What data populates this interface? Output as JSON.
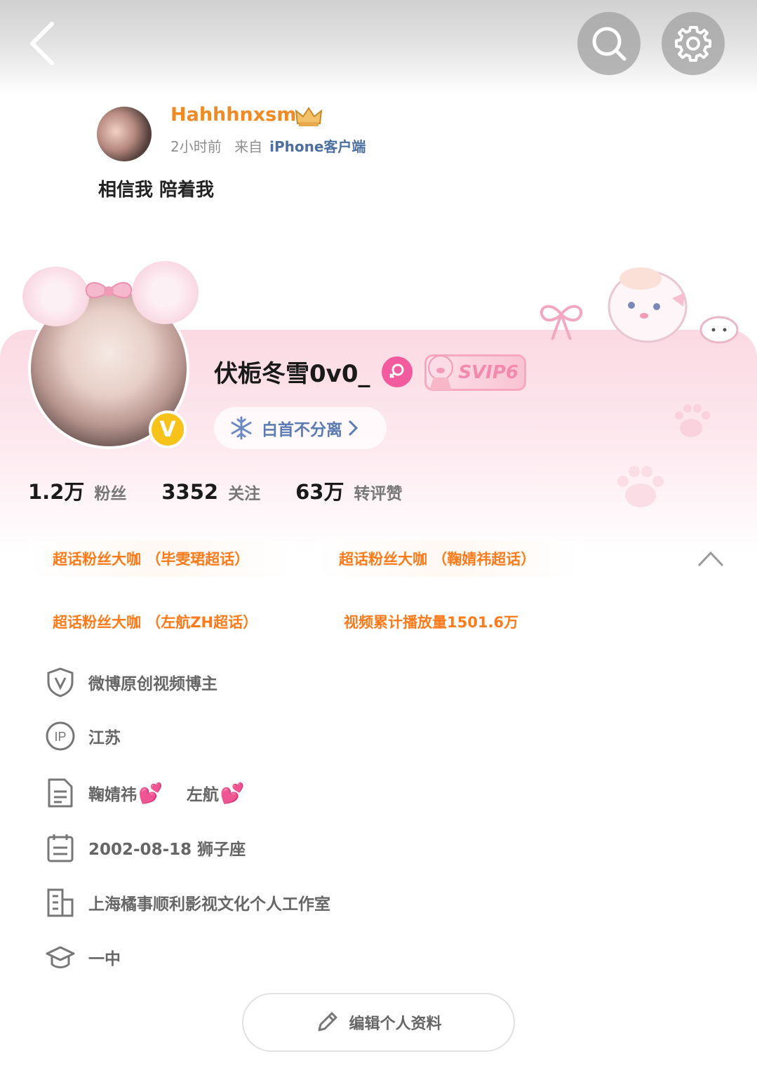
{
  "header": {
    "back_icon": "chevron-left-icon",
    "search_icon": "search-icon",
    "settings_icon": "gear-icon"
  },
  "post": {
    "username": "Hahhhnxsm",
    "time": "2小时前",
    "source_prefix": "来自",
    "source": "iPhone客户端",
    "text": "相信我 陪着我"
  },
  "profile": {
    "name": "伏栀冬雪0v0_",
    "vip_label": "SVIP6",
    "group_label": "白首不分离",
    "colors": {
      "accent_pink": "#f25b9d",
      "badge_orange": "#ff7a1a",
      "verified_gold": "#f7c21a",
      "group_blue": "#5b7bb3"
    }
  },
  "stats": [
    {
      "num": "1.2万",
      "label": "粉丝"
    },
    {
      "num": "3352",
      "label": "关注"
    },
    {
      "num": "63万",
      "label": "转评赞"
    }
  ],
  "fan_badges": [
    "超话粉丝大咖 （毕雯珺超话）",
    "超话粉丝大咖 （鞠婧祎超话）",
    "超话粉丝大咖 （左航ZH超话）",
    "视频累计播放量1501.6万"
  ],
  "info": {
    "verification": "微博原创视频博主",
    "ip": "江苏",
    "bio_1": "鞠婧祎",
    "bio_2": "左航",
    "birthday": "2002-08-18 狮子座",
    "company": "上海橘事顺利影视文化个人工作室",
    "school": "一中"
  },
  "edit_button": "编辑个人资料"
}
